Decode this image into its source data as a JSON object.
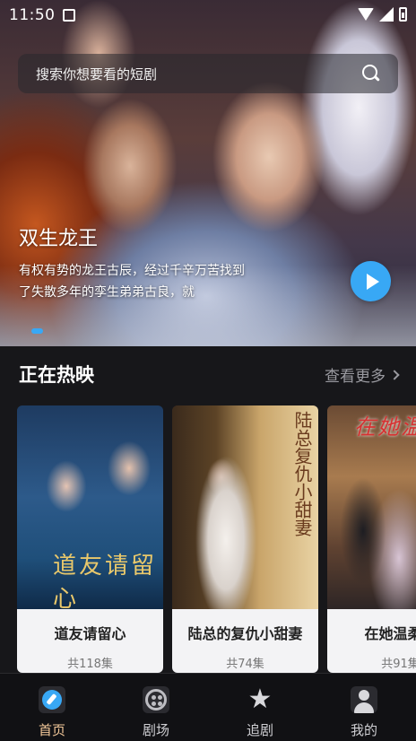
{
  "status_bar": {
    "time": "11:50"
  },
  "search": {
    "placeholder": "搜索你想要看的短剧"
  },
  "banner": {
    "title": "双生龙王",
    "description": "有权有势的龙王古辰，经过千辛万苦找到了失散多年的孪生弟弟古良，就",
    "accent_color": "#38a8f5"
  },
  "section": {
    "title": "正在热映",
    "see_more": "查看更多"
  },
  "dramas": [
    {
      "title": "道友请留心",
      "episodes": "共118集",
      "poster_text": "道友请留心"
    },
    {
      "title": "陆总的复仇小甜妻",
      "episodes": "共74集",
      "poster_text": "陆总复仇小甜妻"
    },
    {
      "title": "在她温柔里",
      "episodes": "共91集",
      "poster_text": "在她温柔里"
    }
  ],
  "nav": {
    "items": [
      {
        "label": "首页",
        "icon": "home-icon",
        "active": true
      },
      {
        "label": "剧场",
        "icon": "theater-icon",
        "active": false
      },
      {
        "label": "追剧",
        "icon": "star-icon",
        "active": false
      },
      {
        "label": "我的",
        "icon": "profile-icon",
        "active": false
      }
    ],
    "active_color": "#f4c99a"
  }
}
